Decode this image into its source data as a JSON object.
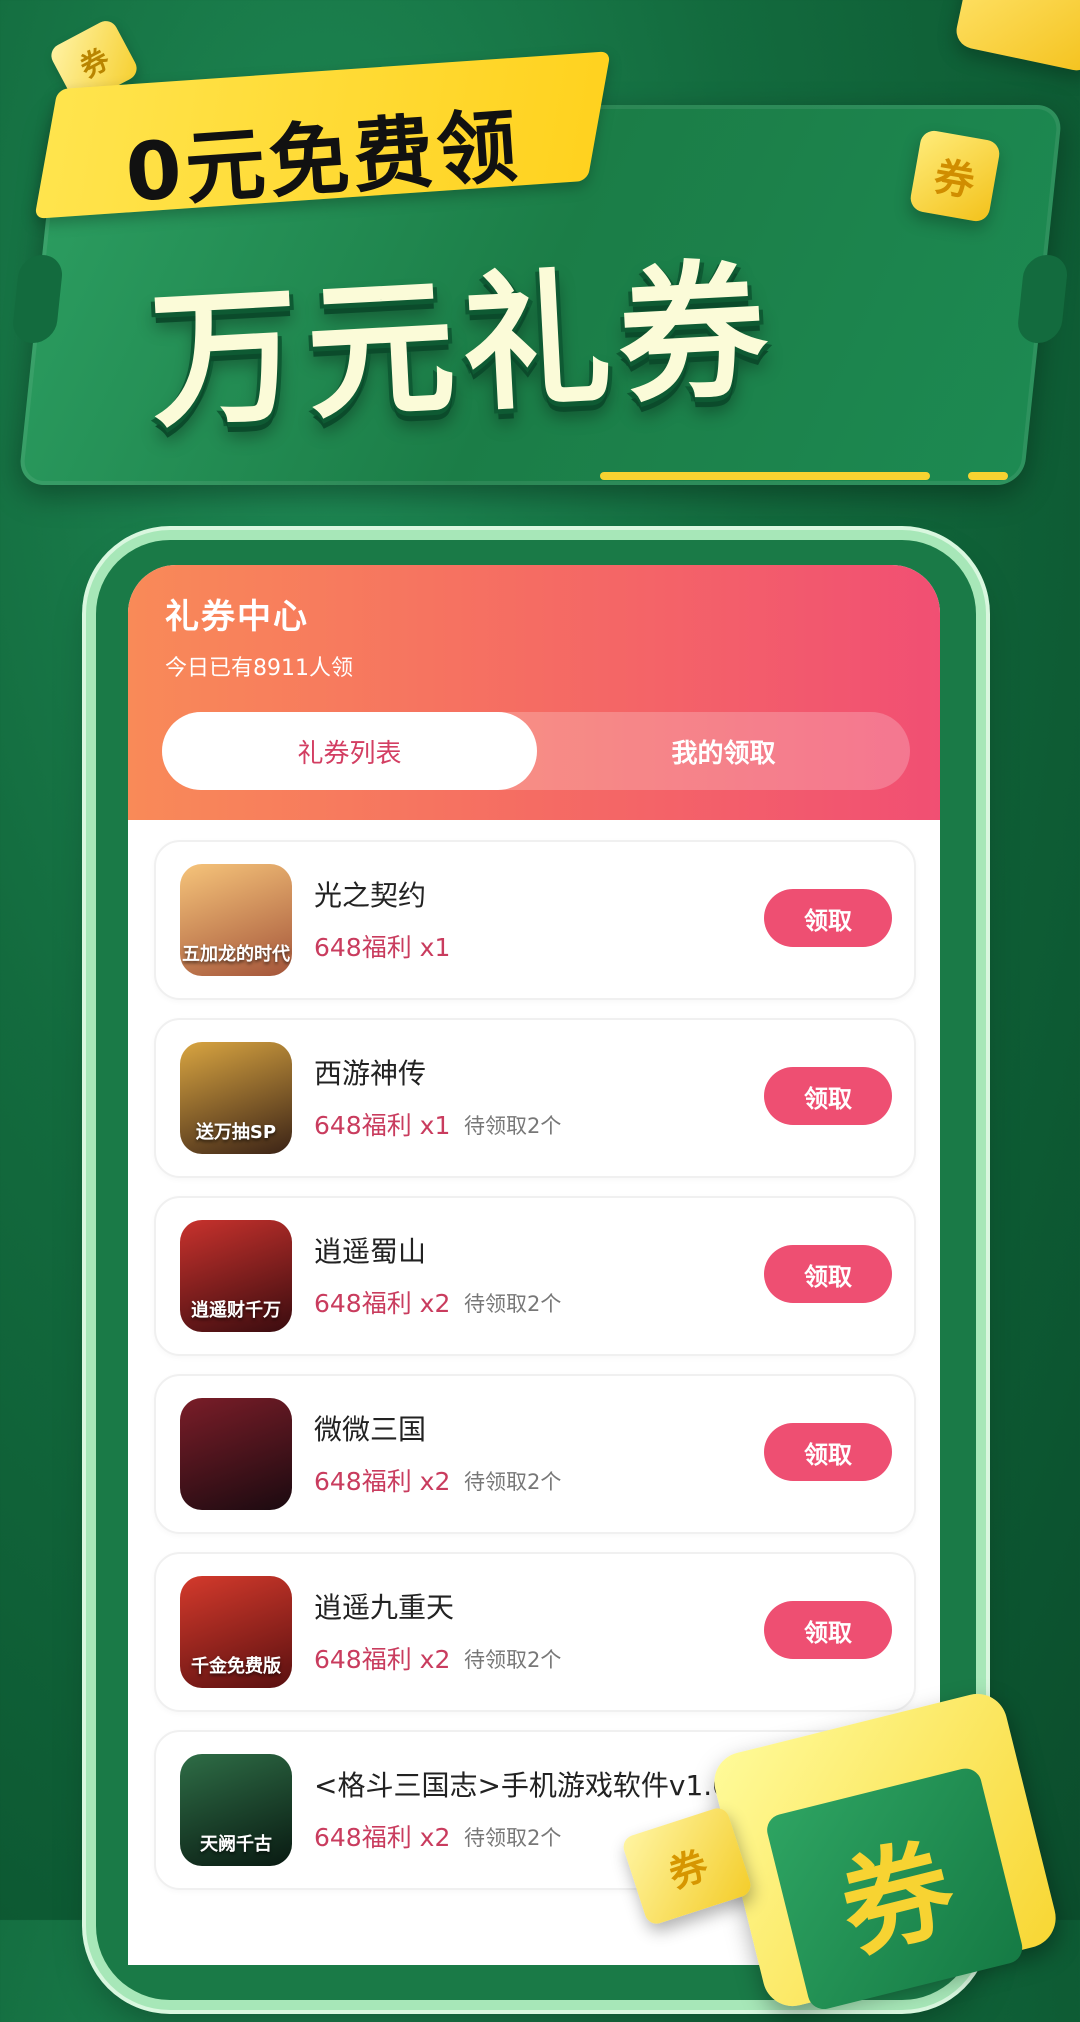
{
  "hero": {
    "banner_text": "0元免费领",
    "title": "万元礼券",
    "coupon_char": "券"
  },
  "header": {
    "title": "礼券中心",
    "subtitle": "今日已有8911人领"
  },
  "tabs": [
    {
      "label": "礼券列表",
      "active": true
    },
    {
      "label": "我的领取",
      "active": false
    }
  ],
  "games": [
    {
      "name": "光之契约",
      "reward": "648福利 x1",
      "pending": "",
      "icon_caption": "五加龙的时代",
      "button": "领取",
      "icon_colors": [
        "#f6c47a",
        "#a4553a"
      ]
    },
    {
      "name": "西游神传",
      "reward": "648福利 x1",
      "pending": "待领取2个",
      "icon_caption": "送万抽SP",
      "button": "领取",
      "icon_colors": [
        "#d9a541",
        "#3b2316"
      ]
    },
    {
      "name": "逍遥蜀山",
      "reward": "648福利 x2",
      "pending": "待领取2个",
      "icon_caption": "逍遥财千万",
      "button": "领取",
      "icon_colors": [
        "#c8322d",
        "#3a0c0f"
      ]
    },
    {
      "name": "微微三国",
      "reward": "648福利 x2",
      "pending": "待领取2个",
      "icon_caption": "",
      "button": "领取",
      "icon_colors": [
        "#7a1d28",
        "#1b0a10"
      ]
    },
    {
      "name": "逍遥九重天",
      "reward": "648福利 x2",
      "pending": "待领取2个",
      "icon_caption": "千金免费版",
      "button": "领取",
      "icon_colors": [
        "#d43a2c",
        "#5a1010"
      ]
    },
    {
      "name": "<格斗三国志>手机游戏软件v1.0",
      "reward": "648福利 x2",
      "pending": "待领取2个",
      "icon_caption": "天阙千古",
      "button": "",
      "icon_colors": [
        "#2e6d46",
        "#091a12"
      ]
    }
  ],
  "colors": {
    "accent": "#ee4f72",
    "header_start": "#f98a58",
    "header_end": "#f14f73",
    "background": "#136b3e"
  }
}
